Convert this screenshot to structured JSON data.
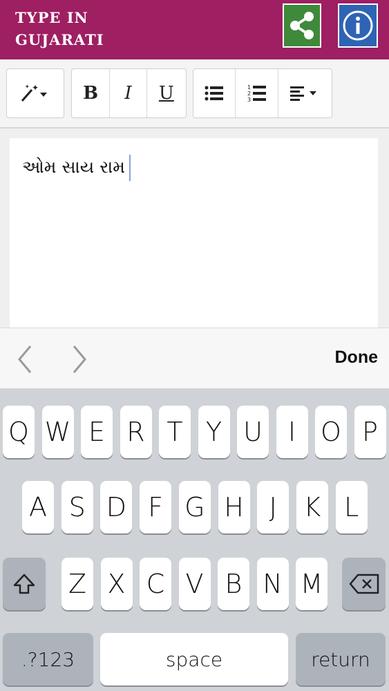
{
  "app": {
    "title": "TYPE IN GUJARATI"
  },
  "header": {
    "share_icon": "share-icon",
    "info_icon": "info-icon"
  },
  "toolbar": {
    "magic_icon": "magic-wand-icon",
    "bold": "B",
    "italic": "I",
    "underline": "U",
    "bullet_list_icon": "bulleted-list-icon",
    "numbered_list_icon": "numbered-list-icon",
    "align_icon": "align-left-icon"
  },
  "editor": {
    "text": "ઓમ સાય રામ"
  },
  "accessory": {
    "done": "Done"
  },
  "keyboard": {
    "row1": [
      "Q",
      "W",
      "E",
      "R",
      "T",
      "Y",
      "U",
      "I",
      "O",
      "P"
    ],
    "row2": [
      "A",
      "S",
      "D",
      "F",
      "G",
      "H",
      "J",
      "K",
      "L"
    ],
    "row3": [
      "Z",
      "X",
      "C",
      "V",
      "B",
      "N",
      "M"
    ],
    "numbers": ".?123",
    "space": "space",
    "return": "return",
    "shift_icon": "shift-icon",
    "backspace_icon": "backspace-icon"
  },
  "colors": {
    "appbar": "#9e1f62",
    "share": "#3f8a3a",
    "info": "#2f64b4"
  }
}
